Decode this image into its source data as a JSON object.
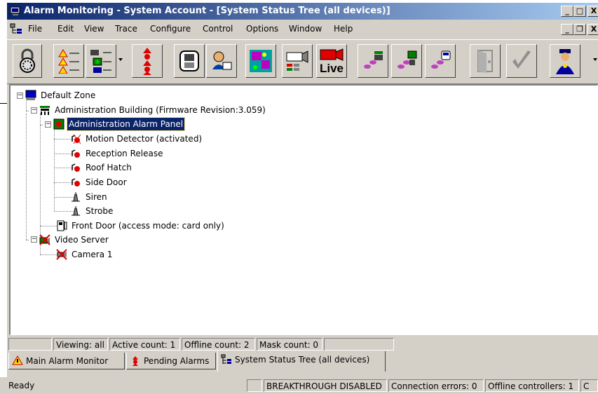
{
  "window": {
    "title": "Alarm Monitoring - System Account - [System Status Tree (all devices)]",
    "min_label": "_",
    "restore_label": "□",
    "close_label": "X"
  },
  "menu": {
    "items": [
      "File",
      "Edit",
      "View",
      "Trace",
      "Configure",
      "Control",
      "Options",
      "Window",
      "Help"
    ],
    "mdi_min": "_",
    "mdi_restore": "❐",
    "mdi_close": "X"
  },
  "toolbar": {
    "live_label": "Live"
  },
  "tree": {
    "root": "Default Zone",
    "building": "Administration Building (Firmware Revision:3.059)",
    "panel": "Administration Alarm Panel",
    "children": [
      "Motion Detector (activated)",
      "Reception Release",
      "Roof Hatch",
      "Side Door",
      "Siren",
      "Strobe"
    ],
    "front_door": "Front Door (access mode: card only)",
    "video_server": "Video Server",
    "camera": "Camera 1"
  },
  "counts_bar": {
    "viewing": "Viewing: all",
    "active": "Active count: 1",
    "offline": "Offline count: 2",
    "mask": "Mask count: 0"
  },
  "tabs": [
    {
      "label": "Main Alarm Monitor"
    },
    {
      "label": "Pending Alarms"
    },
    {
      "label": "System Status Tree (all devices)"
    }
  ],
  "statusbar": {
    "ready": "Ready",
    "breakthrough": "BREAKTHROUGH DISABLED",
    "connection_errors": "Connection errors: 0",
    "offline_controllers": "Offline controllers: 1",
    "extra": "C"
  },
  "colors": {
    "title_start": "#0a246a",
    "title_end": "#a6caf0",
    "selection": "#0a246a",
    "alarm_red": "#e00000"
  }
}
